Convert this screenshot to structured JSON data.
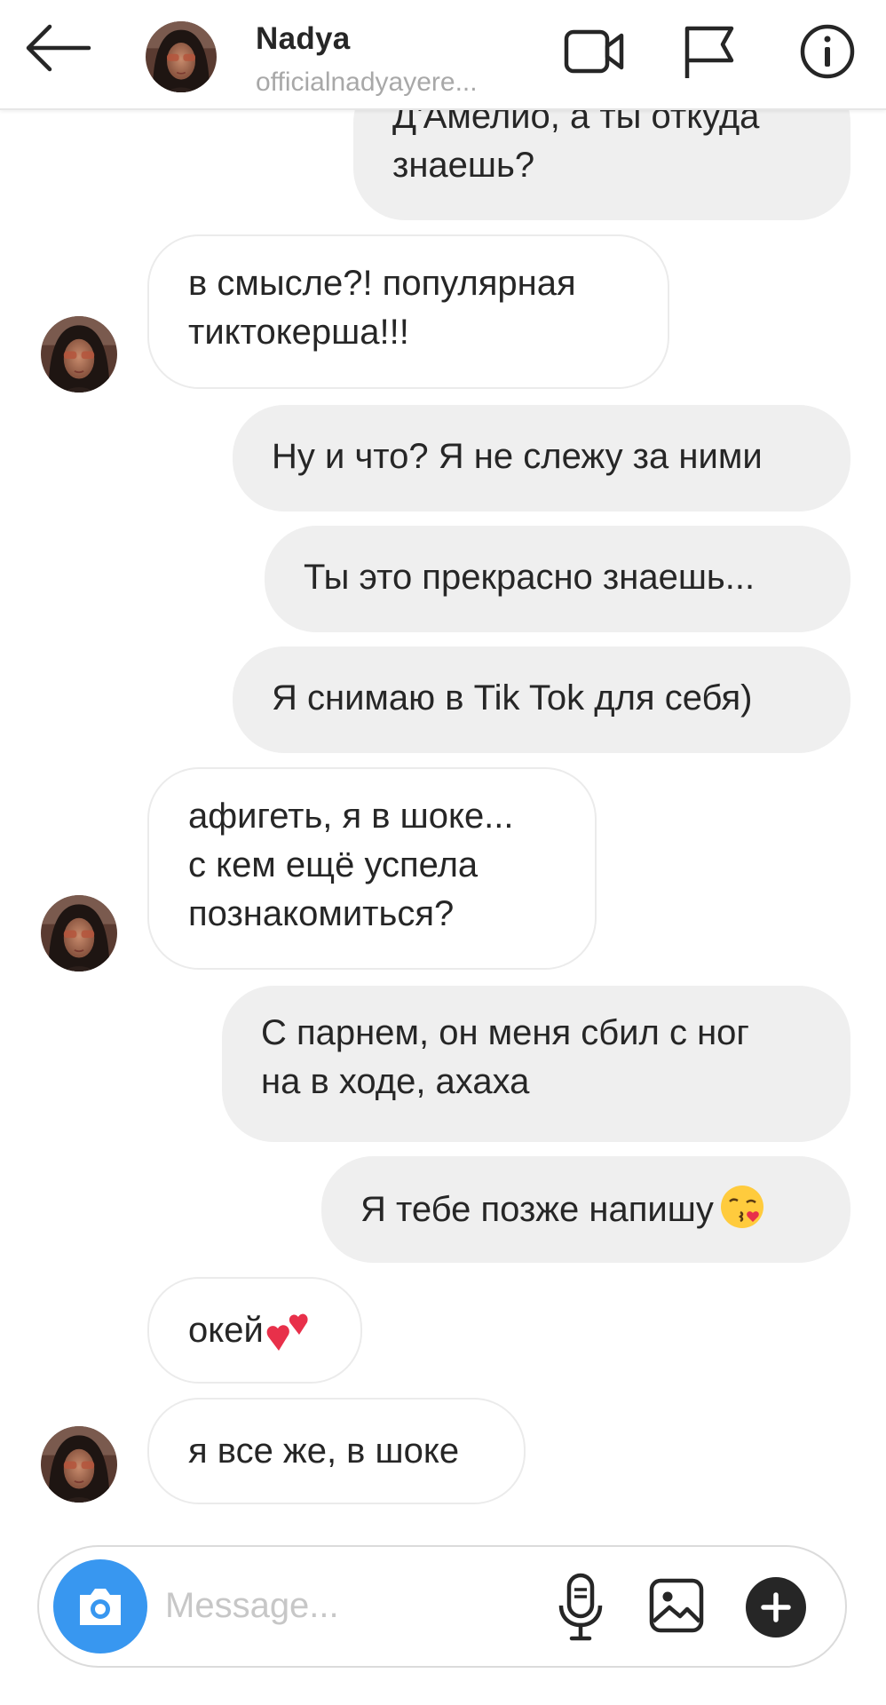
{
  "header": {
    "title": "Nadya",
    "subtitle": "officialnadyayere..."
  },
  "icons": {
    "back": "arrow-left-icon",
    "video": "video-camera-icon",
    "flag": "flag-icon",
    "info": "info-icon",
    "camera": "camera-icon",
    "mic": "microphone-icon",
    "gallery": "image-icon",
    "plus": "plus-icon"
  },
  "messages": [
    {
      "side": "out",
      "text": "Д'Амелио, а ты откуда\nзнаешь?"
    },
    {
      "side": "in",
      "text": "в смысле?! популярная\nтиктокерша!!!"
    },
    {
      "side": "out",
      "text": "Ну и что? Я не слежу за ними"
    },
    {
      "side": "out",
      "text": "Ты это прекрасно знаешь..."
    },
    {
      "side": "out",
      "text": "Я снимаю в Tik Tok для себя)"
    },
    {
      "side": "in",
      "text": "афигеть, я в шоке...\nс кем ещё успела\nпознакомиться?"
    },
    {
      "side": "out",
      "text": "С парнем, он меня сбил с ног\nна в ходе, ахаха"
    },
    {
      "side": "out",
      "text": "Я тебе позже напишу",
      "emoji": "face-blowing-kiss-emoji"
    },
    {
      "side": "in",
      "text": "окей",
      "emoji": "two-hearts-emoji"
    },
    {
      "side": "in",
      "text": "я все же, в шоке"
    }
  ],
  "composer": {
    "placeholder": "Message..."
  },
  "colors": {
    "outgoing_bubble": "#efefef",
    "incoming_border": "#ebebeb",
    "camera_button": "#3897f0",
    "placeholder": "#c7c7c7",
    "subtitle": "#a8a8a8"
  }
}
